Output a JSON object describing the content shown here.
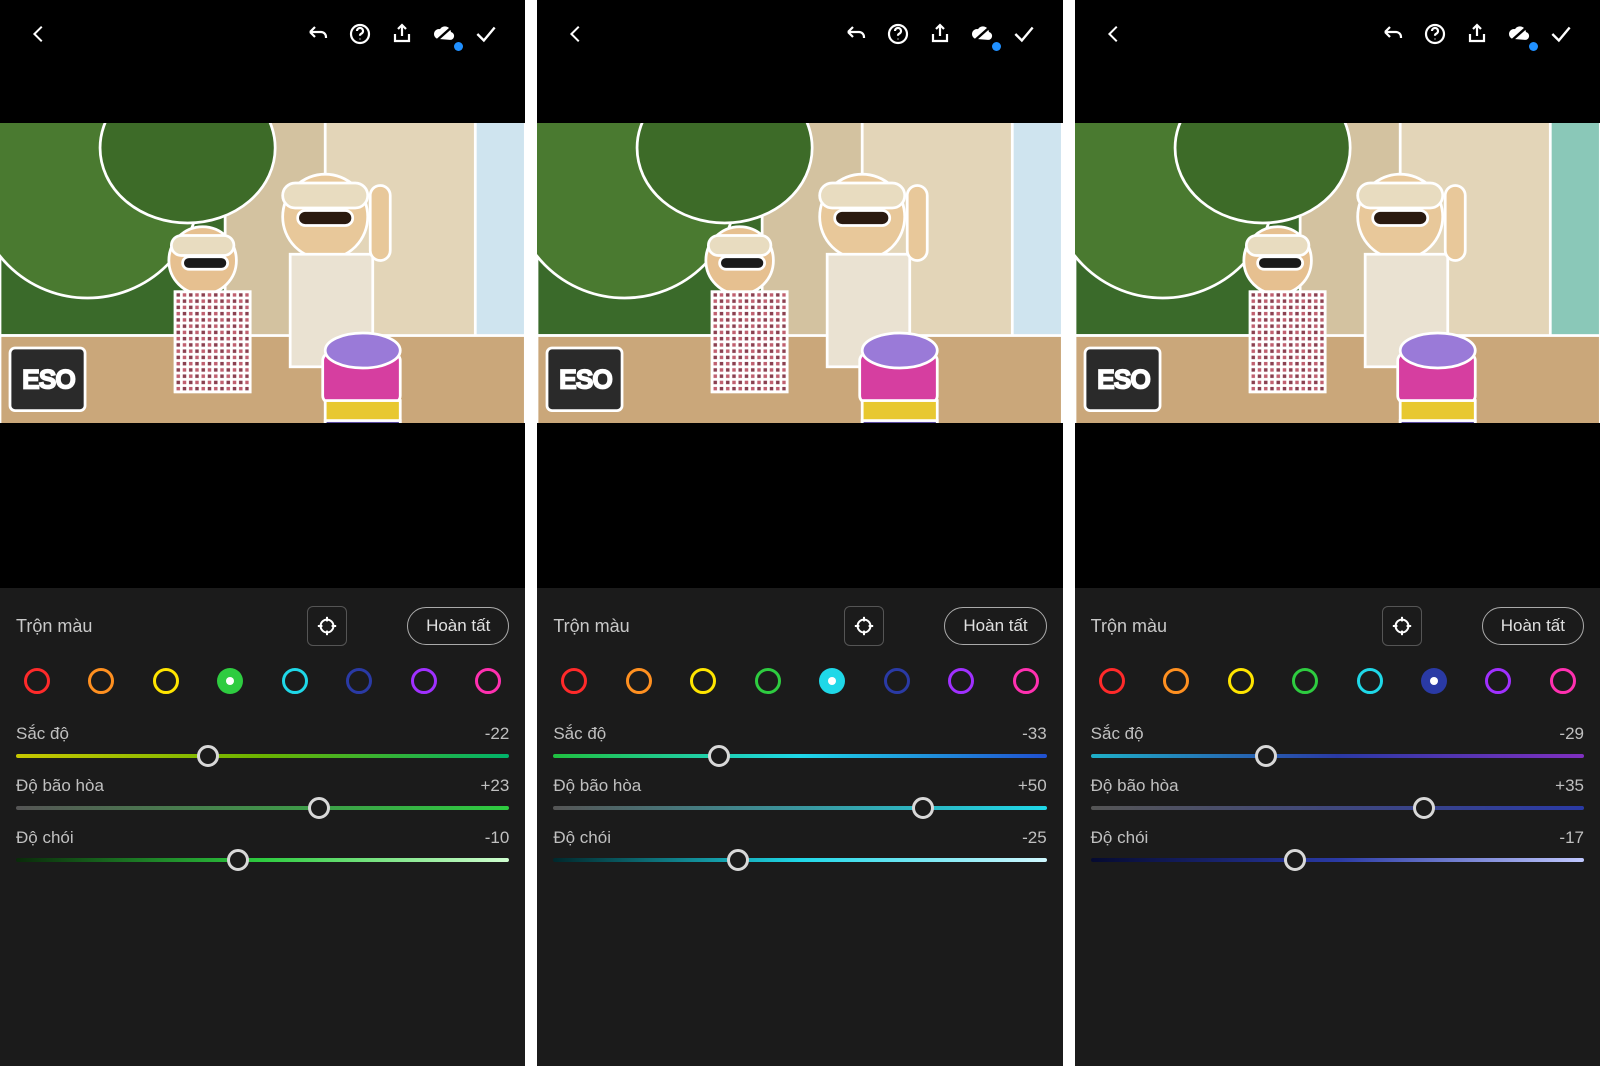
{
  "toolbarIcons": [
    "back",
    "undo",
    "help",
    "share",
    "cloud",
    "confirm"
  ],
  "panelTitle": "Trộn màu",
  "doneLabel": "Hoàn tất",
  "sliderLabels": {
    "hue": "Sắc độ",
    "saturation": "Độ bão hòa",
    "luminance": "Độ chói"
  },
  "swatchColors": [
    "#ff2a2a",
    "#ff9020",
    "#ffe500",
    "#2ecc40",
    "#1fd8e8",
    "#2a3aa5",
    "#a030ff",
    "#ff30b0"
  ],
  "screens": [
    {
      "selectedSwatch": 3,
      "selectedFill": "#2ecc40",
      "sliders": {
        "hue": {
          "value": -22,
          "gradient": "linear-gradient(90deg,#c8c800 0%,#6bb300 50%,#00b36b 100%)"
        },
        "saturation": {
          "value": 23,
          "gradient": "linear-gradient(90deg,#555 0%,#2ecc40 100%)"
        },
        "luminance": {
          "value": -10,
          "gradient": "linear-gradient(90deg,#0a2a0a 0%,#2ecc40 50%,#d0ffd0 100%)"
        }
      }
    },
    {
      "selectedSwatch": 4,
      "selectedFill": "#1fd8e8",
      "sliders": {
        "hue": {
          "value": -33,
          "gradient": "linear-gradient(90deg,#20c040 0%,#1fd8e8 50%,#2050d0 100%)"
        },
        "saturation": {
          "value": 50,
          "gradient": "linear-gradient(90deg,#555 0%,#1fd8e8 100%)"
        },
        "luminance": {
          "value": -25,
          "gradient": "linear-gradient(90deg,#00282c 0%,#1fd8e8 50%,#d0f8ff 100%)"
        }
      }
    },
    {
      "selectedSwatch": 5,
      "selectedFill": "#2a3aa5",
      "sliders": {
        "hue": {
          "value": -29,
          "gradient": "linear-gradient(90deg,#1fb0c8 0%,#2a3aa5 50%,#8030c0 100%)"
        },
        "saturation": {
          "value": 35,
          "gradient": "linear-gradient(90deg,#555 0%,#2a3aa5 100%)"
        },
        "luminance": {
          "value": -17,
          "gradient": "linear-gradient(90deg,#050a30 0%,#2a3aa5 50%,#c0c8ff 100%)"
        }
      }
    }
  ]
}
